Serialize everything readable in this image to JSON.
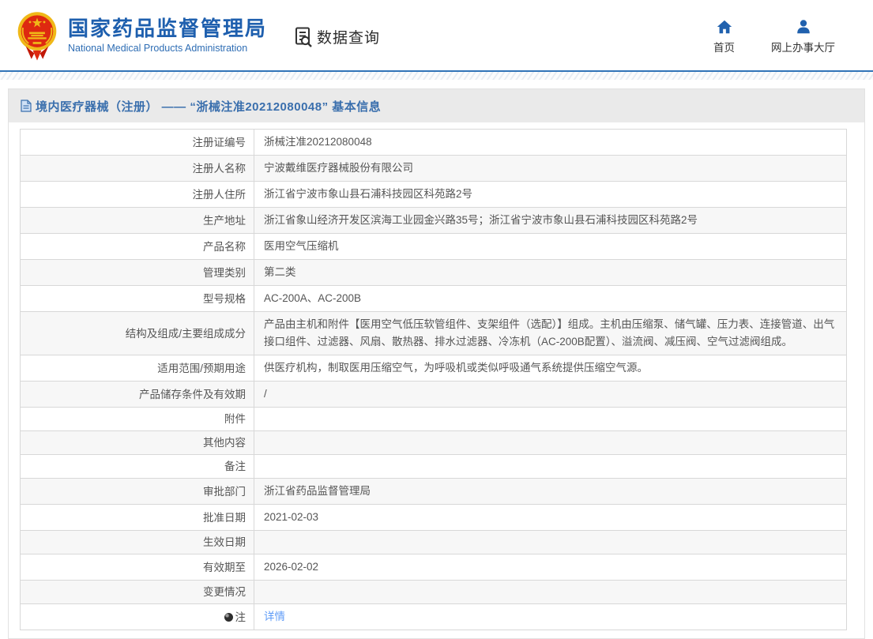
{
  "header": {
    "brand": {
      "title": "国家药品监督管理局",
      "subtitle": "National Medical Products Administration",
      "emblem_icon": "national-emblem-icon"
    },
    "section": {
      "label": "数据查询",
      "icon": "document-search-icon"
    },
    "nav": [
      {
        "label": "首页",
        "icon": "home-icon"
      },
      {
        "label": "网上办事大厅",
        "icon": "person-icon"
      }
    ]
  },
  "panel": {
    "title": "境内医疗器械（注册） —— “浙械注准20212080048” 基本信息",
    "title_icon": "document-page-icon"
  },
  "table": {
    "rows": [
      {
        "label": "注册证编号",
        "value": "浙械注准20212080048"
      },
      {
        "label": "注册人名称",
        "value": "宁波戴维医疗器械股份有限公司"
      },
      {
        "label": "注册人住所",
        "value": "浙江省宁波市象山县石浦科技园区科苑路2号"
      },
      {
        "label": "生产地址",
        "value": "浙江省象山经济开发区滨海工业园金兴路35号；浙江省宁波市象山县石浦科技园区科苑路2号"
      },
      {
        "label": "产品名称",
        "value": "医用空气压缩机"
      },
      {
        "label": "管理类别",
        "value": "第二类"
      },
      {
        "label": "型号规格",
        "value": "AC-200A、AC-200B"
      },
      {
        "label": "结构及组成/主要组成成分",
        "value": "产品由主机和附件【医用空气低压软管组件、支架组件（选配）】组成。主机由压缩泵、储气罐、压力表、连接管道、出气接口组件、过滤器、风扇、散热器、排水过滤器、冷冻机（AC-200B配置）、溢流阀、减压阀、空气过滤阀组成。"
      },
      {
        "label": "适用范围/预期用途",
        "value": "供医疗机构，制取医用压缩空气，为呼吸机或类似呼吸通气系统提供压缩空气源。"
      },
      {
        "label": "产品储存条件及有效期",
        "value": "/"
      },
      {
        "label": "附件",
        "value": ""
      },
      {
        "label": "其他内容",
        "value": ""
      },
      {
        "label": "备注",
        "value": ""
      },
      {
        "label": "审批部门",
        "value": "浙江省药品监督管理局"
      },
      {
        "label": "批准日期",
        "value": "2021-02-03"
      },
      {
        "label": "生效日期",
        "value": ""
      },
      {
        "label": "有效期至",
        "value": "2026-02-02"
      },
      {
        "label": "变更情况",
        "value": ""
      },
      {
        "label": "注",
        "label_icon": "note-dot-icon",
        "link": "详情"
      }
    ]
  },
  "colors": {
    "accent_blue": "#2e6db4",
    "brand_blue": "#1e5fae",
    "panel_title_blue": "#3a6fad",
    "link_blue": "#5e9bf7",
    "title_bar_bg": "#eaeaea",
    "row_alt_bg": "#f7f7f7",
    "border": "#d8d8d8",
    "emblem_red": "#de2910",
    "emblem_gold": "#f0b818"
  }
}
